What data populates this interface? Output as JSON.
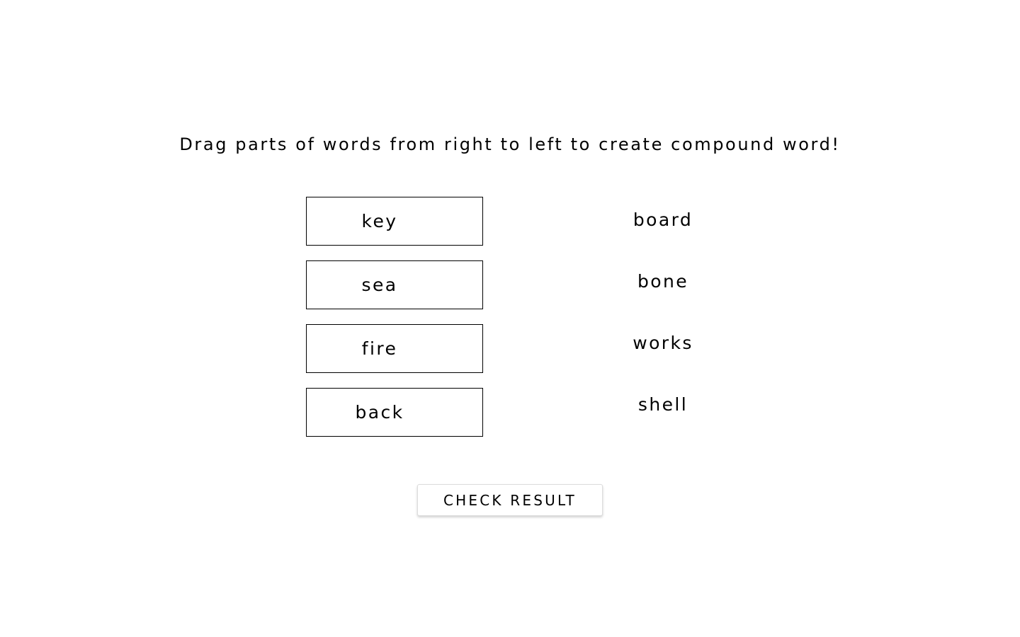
{
  "instruction": "Drag parts of words from right to left to create compound word!",
  "left_slots": [
    {
      "label": "key"
    },
    {
      "label": "sea"
    },
    {
      "label": "fire"
    },
    {
      "label": "back"
    }
  ],
  "right_words": [
    {
      "label": "board"
    },
    {
      "label": "bone"
    },
    {
      "label": "works"
    },
    {
      "label": "shell"
    }
  ],
  "check_button_label": "CHECK RESULT"
}
